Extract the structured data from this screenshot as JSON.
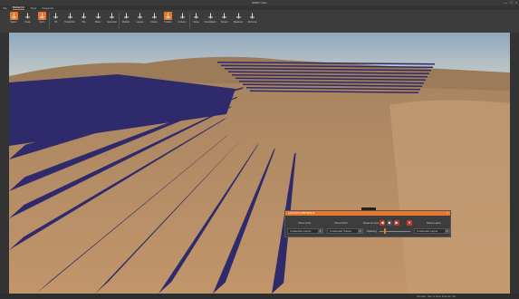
{
  "window": {
    "title": "SWIFT Visio",
    "controls": [
      "—",
      "□",
      "×"
    ]
  },
  "menu": {
    "items": [
      "File",
      "Builder(A)",
      "Tools",
      "Viewpoint"
    ],
    "active_index": 1
  },
  "ribbon": {
    "buttons": [
      {
        "label": "Select",
        "highlight": true
      },
      {
        "label": "Snap",
        "highlight": false
      },
      {
        "label": "Grid",
        "highlight": true
      },
      {
        "label": "Tilt",
        "highlight": false
      },
      {
        "label": "Transform",
        "highlight": false
      },
      {
        "label": "Pile",
        "highlight": false
      },
      {
        "label": "Place",
        "highlight": false
      },
      {
        "label": "Generate",
        "highlight": false
      },
      {
        "label": "Module",
        "highlight": false
      },
      {
        "label": "Layout",
        "highlight": false
      },
      {
        "label": "Frame",
        "highlight": false
      },
      {
        "label": "Tracker",
        "highlight": true
      },
      {
        "label": "Column",
        "highlight": false
      },
      {
        "label": "Slope",
        "highlight": false
      },
      {
        "label": "Foundation",
        "highlight": false
      },
      {
        "label": "Terrain",
        "highlight": false
      },
      {
        "label": "Measure",
        "highlight": false
      },
      {
        "label": "Remove",
        "highlight": false
      }
    ]
  },
  "panel": {
    "title": "LAYOUT CONTROLS",
    "close": "×",
    "labels": [
      "Show Grid",
      "Show Path",
      "Draw Arrows",
      "Show Label"
    ],
    "dropdowns": [
      "Unselected Layout",
      "Unselected Tracker",
      "Unselected Layout"
    ],
    "slider_label": "Spacing",
    "slider_value": 0.15,
    "buttons": [
      "◀",
      "■",
      "▶",
      "✕"
    ]
  },
  "status": {
    "text": "Render: Sat 12.4ms Frames: 60"
  },
  "colors": {
    "accent": "#e8772e",
    "sky_top": "#9fb5c7",
    "sky_bottom": "#c9ccc7",
    "sand": "#b68a60",
    "panel_blue": "#2e2a6b"
  }
}
